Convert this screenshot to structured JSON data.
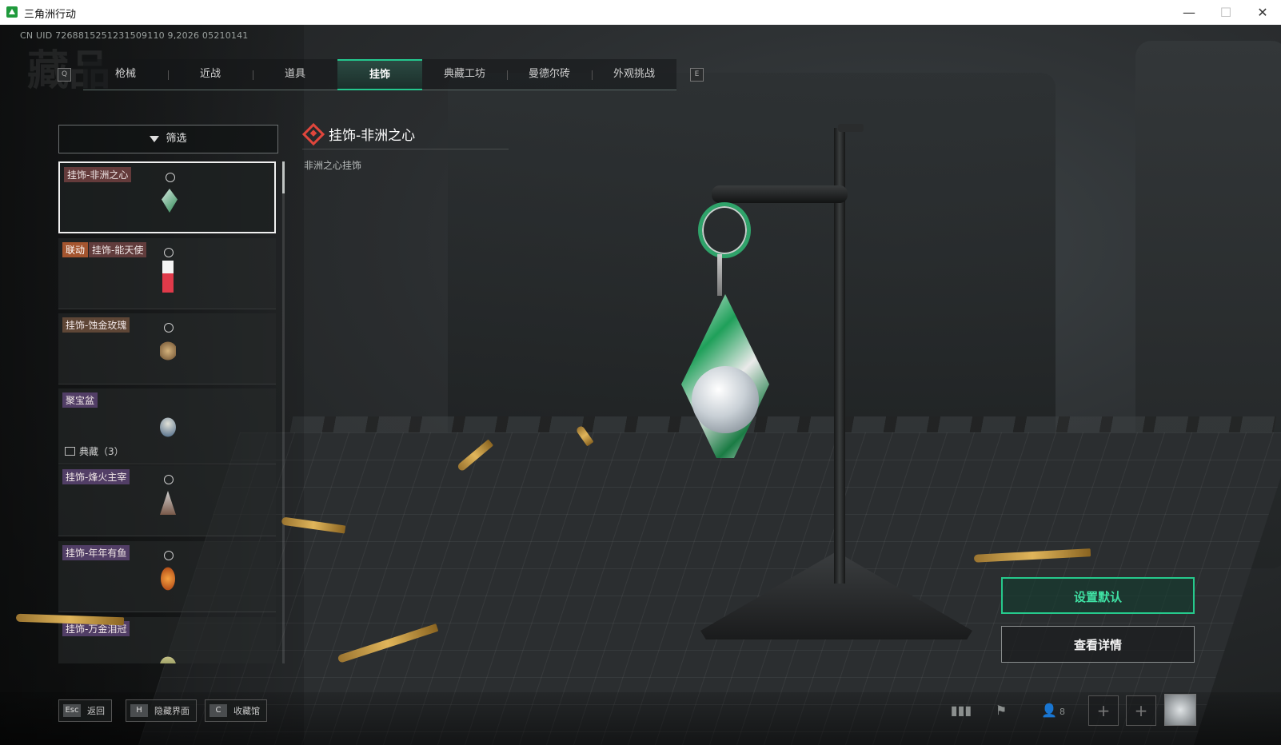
{
  "window": {
    "title": "三角洲行动",
    "min": "—",
    "max": "☐",
    "close": "✕"
  },
  "uid_text": "CN UID 7268815251231509110 9,2026 05210141",
  "bg_heading": "藏品",
  "tabs": {
    "prev_key": "Q",
    "next_key": "E",
    "items": [
      {
        "label": "枪械"
      },
      {
        "label": "近战"
      },
      {
        "label": "道具"
      },
      {
        "label": "挂饰"
      },
      {
        "label": "典藏工坊"
      },
      {
        "label": "曼德尔砖"
      },
      {
        "label": "外观挑战"
      }
    ],
    "active_index": 3
  },
  "filter": {
    "label": "筛选",
    "icon": "filter-icon"
  },
  "list": {
    "items": [
      {
        "label": "挂饰-非洲之心",
        "selected": true
      },
      {
        "collab_tag": "联动",
        "label": "挂饰-能天使"
      },
      {
        "label": "挂饰-蚀金玫瑰"
      },
      {
        "label": "聚宝盆",
        "collection_note": "典藏（3）"
      },
      {
        "label": "挂饰-烽火主宰"
      },
      {
        "label": "挂饰-年年有鱼"
      },
      {
        "label": "挂饰-万金泪冠"
      }
    ]
  },
  "detail": {
    "title": "挂饰-非洲之心",
    "subtitle": "非洲之心挂饰",
    "icon": "diamond-icon"
  },
  "actions": {
    "set_default": "设置默认",
    "view_details": "查看详情"
  },
  "bottom": {
    "hints": [
      {
        "key": "Esc",
        "label": "返回"
      },
      {
        "key": "H",
        "label": "隐藏界面"
      },
      {
        "key": "C",
        "label": "收藏馆"
      }
    ],
    "friend_count": "8",
    "slot_plus": "+"
  },
  "colors": {
    "accent": "#26c98c",
    "detail_icon": "#e0463c",
    "collab_tag": "#a4552f"
  }
}
